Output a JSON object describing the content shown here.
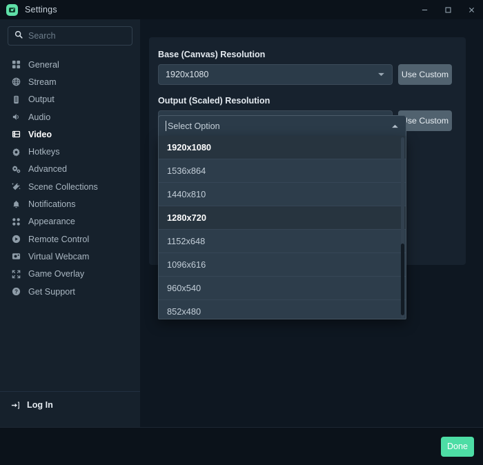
{
  "window": {
    "title": "Settings",
    "app_icon": "webcam-icon",
    "controls": {
      "minimize": "minimize-icon",
      "maximize": "maximize-icon",
      "close": "close-icon"
    }
  },
  "sidebar": {
    "search": {
      "value": "",
      "placeholder": "Search",
      "icon": "search-icon"
    },
    "items": [
      {
        "label": "General",
        "icon": "grid-icon",
        "active": false
      },
      {
        "label": "Stream",
        "icon": "globe-icon",
        "active": false
      },
      {
        "label": "Output",
        "icon": "server-icon",
        "active": false
      },
      {
        "label": "Audio",
        "icon": "speaker-icon",
        "active": false
      },
      {
        "label": "Video",
        "icon": "film-icon",
        "active": true
      },
      {
        "label": "Hotkeys",
        "icon": "gear-icon",
        "active": false
      },
      {
        "label": "Advanced",
        "icon": "sliders-icon",
        "active": false
      },
      {
        "label": "Scene Collections",
        "icon": "wand-icon",
        "active": false
      },
      {
        "label": "Notifications",
        "icon": "bell-icon",
        "active": false
      },
      {
        "label": "Appearance",
        "icon": "dots-grid-icon",
        "active": false
      },
      {
        "label": "Remote Control",
        "icon": "play-circle-icon",
        "active": false
      },
      {
        "label": "Virtual Webcam",
        "icon": "camera-icon",
        "active": false
      },
      {
        "label": "Game Overlay",
        "icon": "expand-icon",
        "active": false
      },
      {
        "label": "Get Support",
        "icon": "help-circle-icon",
        "active": false
      }
    ],
    "footer": {
      "login_label": "Log In",
      "login_icon": "sign-in-icon"
    }
  },
  "content": {
    "base_resolution": {
      "label": "Base (Canvas) Resolution",
      "value": "1920x1080",
      "custom_button": "Use Custom",
      "caret_icon": "chevron-down-icon"
    },
    "output_resolution": {
      "label": "Output (Scaled) Resolution",
      "value": "Select Option",
      "custom_button": "Use Custom",
      "caret_icon": "chevron-up-icon",
      "expanded": true,
      "options": [
        {
          "label": "1920x1080",
          "highlighted": true
        },
        {
          "label": "1536x864",
          "highlighted": false
        },
        {
          "label": "1440x810",
          "highlighted": false
        },
        {
          "label": "1280x720",
          "highlighted": true
        },
        {
          "label": "1152x648",
          "highlighted": false
        },
        {
          "label": "1096x616",
          "highlighted": false
        },
        {
          "label": "960x540",
          "highlighted": false
        },
        {
          "label": "852x480",
          "highlighted": false
        }
      ]
    },
    "obscured_selects": [
      {
        "value": "",
        "caret_icon": "chevron-down-icon"
      },
      {
        "value": "",
        "caret_icon": "chevron-down-icon"
      },
      {
        "value": "",
        "caret_icon": "chevron-down-icon"
      }
    ]
  },
  "footer": {
    "done_label": "Done",
    "accent_color": "#4ddda5"
  }
}
